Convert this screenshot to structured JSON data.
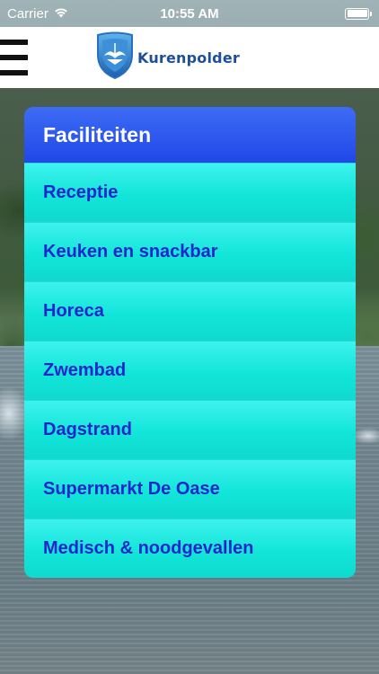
{
  "status_bar": {
    "carrier": "Carrier",
    "time": "10:55 AM",
    "wifi_icon": "wifi-icon",
    "battery_icon": "battery-icon"
  },
  "header": {
    "menu_icon": "hamburger-menu-icon",
    "logo_text": "Kurenpolder",
    "brand_color": "#1e4f9a"
  },
  "menu": {
    "title": "Faciliteiten",
    "header_color": "#2a50ec",
    "item_color": "#18e8dd",
    "item_text_color": "#2226cc",
    "items": [
      {
        "label": "Receptie"
      },
      {
        "label": "Keuken en snackbar"
      },
      {
        "label": "Horeca"
      },
      {
        "label": "Zwembad"
      },
      {
        "label": "Dagstrand"
      },
      {
        "label": "Supermarkt De Oase"
      },
      {
        "label": "Medisch & noodgevallen"
      }
    ]
  }
}
